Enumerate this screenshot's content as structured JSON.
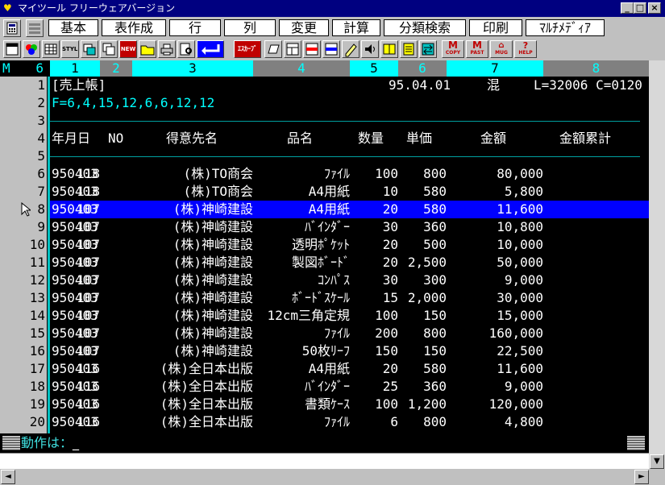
{
  "window": {
    "title": "マイツール フリーウェアバージョン",
    "minimize": "_",
    "maximize": "□",
    "close": "×"
  },
  "menu": [
    "基本",
    "表作成",
    "行",
    "列",
    "変更",
    "計算",
    "分類検索",
    "印刷",
    "ﾏﾙﾁﾒﾃﾞｨｱ"
  ],
  "toolbar": {
    "style_label": "STYLE",
    "new_label": "NEW",
    "ezcard_label": "ｴｽｶｰﾌﾞ",
    "m_copy": "COPY",
    "m_paste": "PAST",
    "mug_label": "MUG",
    "help_label": "HELP"
  },
  "columns": {
    "mode": "M",
    "count": "6",
    "labels": [
      "1",
      "2",
      "3",
      "4",
      "5",
      "6",
      "7",
      "8"
    ]
  },
  "sheet": {
    "row_numbers": [
      "1",
      "2",
      "3",
      "4",
      "5",
      "6",
      "7",
      "8",
      "9",
      "10",
      "11",
      "12",
      "13",
      "14",
      "15",
      "16",
      "17",
      "18",
      "19",
      "20"
    ],
    "header_title": "[売上帳]",
    "header_date": "95.04.01",
    "header_mode": "混",
    "header_info": "L=32006 C=0120",
    "format_line": "F=6,4,15,12,6,6,12,12",
    "col_headers": [
      "年月日",
      "NO",
      "得意先名",
      "品名",
      "数量",
      "単価",
      "金額",
      "金額累計"
    ],
    "selected_row": 8,
    "rows": [
      [
        "950403",
        "118",
        "(株)TO商会",
        "ﾌｧｲﾙ",
        "100",
        "800",
        "80,000"
      ],
      [
        "950403",
        "118",
        "(株)TO商会",
        "A4用紙",
        "10",
        "580",
        "5,800"
      ],
      [
        "950403",
        "107",
        "(株)神崎建設",
        "A4用紙",
        "20",
        "580",
        "11,600"
      ],
      [
        "950403",
        "107",
        "(株)神崎建設",
        "ﾊﾞｲﾝﾀﾞｰ",
        "30",
        "360",
        "10,800"
      ],
      [
        "950403",
        "107",
        "(株)神崎建設",
        "透明ﾎﾟｹｯﾄ",
        "20",
        "500",
        "10,000"
      ],
      [
        "950403",
        "107",
        "(株)神崎建設",
        "製図ﾎﾞｰﾄﾞ",
        "20",
        "2,500",
        "50,000"
      ],
      [
        "950403",
        "107",
        "(株)神崎建設",
        "ｺﾝﾊﾟｽ",
        "30",
        "300",
        "9,000"
      ],
      [
        "950403",
        "107",
        "(株)神崎建設",
        "ﾎﾞｰﾄﾞｽｹｰﾙ",
        "15",
        "2,000",
        "30,000"
      ],
      [
        "950403",
        "107",
        "(株)神崎建設",
        "12cm三角定規",
        "100",
        "150",
        "15,000"
      ],
      [
        "950403",
        "107",
        "(株)神崎建設",
        "ﾌｧｲﾙ",
        "200",
        "800",
        "160,000"
      ],
      [
        "950403",
        "107",
        "(株)神崎建設",
        "50枚ﾘｰﾌ",
        "150",
        "150",
        "22,500"
      ],
      [
        "950403",
        "116",
        "(株)全日本出版",
        "A4用紙",
        "20",
        "580",
        "11,600"
      ],
      [
        "950403",
        "116",
        "(株)全日本出版",
        "ﾊﾞｲﾝﾀﾞｰ",
        "25",
        "360",
        "9,000"
      ],
      [
        "950403",
        "116",
        "(株)全日本出版",
        "書類ｹｰｽ",
        "100",
        "1,200",
        "120,000"
      ],
      [
        "950403",
        "116",
        "(株)全日本出版",
        "ﾌｧｲﾙ",
        "6",
        "800",
        "4,800"
      ]
    ]
  },
  "status": {
    "prompt": "動作は：",
    "cursor": "_"
  },
  "colors": {
    "titlebar": "#000080",
    "highlight": "#0000ff",
    "cyan": "#00ffff",
    "sheet_bg": "#000000"
  }
}
